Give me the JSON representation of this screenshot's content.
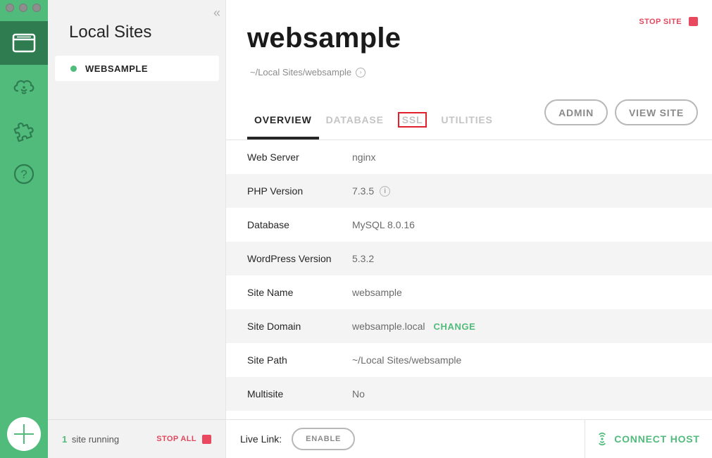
{
  "colors": {
    "rail": "#51bb7b",
    "rail_active": "#2e7c50",
    "accent_green": "#51bb7b",
    "stop_red": "#e0485e",
    "highlight_box": "#e0212d"
  },
  "rail": {
    "items": [
      {
        "icon": "sites-icon",
        "active": true
      },
      {
        "icon": "cloud-icon",
        "active": false
      },
      {
        "icon": "addons-puzzle-icon",
        "active": false
      },
      {
        "icon": "help-icon",
        "glyph": "?",
        "active": false
      }
    ],
    "add_glyph": "+"
  },
  "sites_panel": {
    "collapse_glyph": "«",
    "title": "Local Sites",
    "items": [
      {
        "name": "WEBSAMPLE",
        "status": "running"
      }
    ],
    "footer": {
      "running_count": "1",
      "running_text": "site running",
      "stop_all": "STOP ALL"
    }
  },
  "main": {
    "stop_site": "STOP SITE",
    "title": "websample",
    "path": "~/Local Sites/websample",
    "tabs": [
      {
        "label": "OVERVIEW",
        "active": true
      },
      {
        "label": "DATABASE",
        "active": false
      },
      {
        "label": "SSL",
        "active": false,
        "highlighted": true
      },
      {
        "label": "UTILITIES",
        "active": false
      }
    ],
    "buttons": {
      "admin": "ADMIN",
      "view_site": "VIEW SITE"
    },
    "overview": [
      {
        "label": "Web Server",
        "value": "nginx"
      },
      {
        "label": "PHP Version",
        "value": "7.3.5",
        "info": true
      },
      {
        "label": "Database",
        "value": "MySQL 8.0.16"
      },
      {
        "label": "WordPress Version",
        "value": "5.3.2"
      },
      {
        "label": "Site Name",
        "value": "websample"
      },
      {
        "label": "Site Domain",
        "value": "websample.local",
        "action": "CHANGE"
      },
      {
        "label": "Site Path",
        "value": "~/Local Sites/websample"
      },
      {
        "label": "Multisite",
        "value": "No"
      }
    ],
    "footer": {
      "live_link_label": "Live Link:",
      "enable": "ENABLE",
      "connect_host": "CONNECT HOST"
    }
  }
}
